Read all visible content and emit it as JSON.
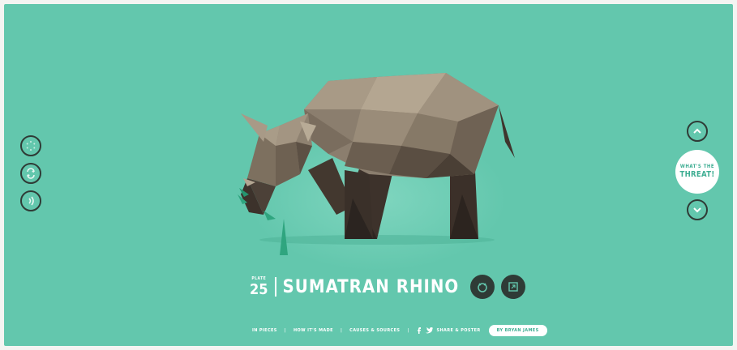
{
  "plate": {
    "label": "PLATE",
    "number": "25"
  },
  "animal_name": "SUMATRAN RHINO",
  "side_nav_left": [
    {
      "icon": "dots-ring-icon"
    },
    {
      "icon": "shuffle-icon"
    },
    {
      "icon": "sound-icon"
    }
  ],
  "side_nav_right": {
    "up_icon": "chevron-up-icon",
    "down_icon": "chevron-down-icon",
    "threat_line1": "WHAT'S THE",
    "threat_line2": "THREAT!"
  },
  "title_actions": [
    {
      "icon": "animal-face-icon"
    },
    {
      "icon": "expand-icon"
    }
  ],
  "footer": {
    "link1": "IN PIECES",
    "link2": "HOW IT'S MADE",
    "link3": "CAUSES & SOURCES",
    "share_label": "SHARE & POSTER",
    "byline": "BY BRYAN JAMES",
    "separator": "|"
  },
  "colors": {
    "background": "#63c7ad",
    "dark": "#2f3b36",
    "accent": "#3fae93",
    "rhino_light": "#ad9f8c",
    "rhino_dark": "#4b3f35",
    "grass": "#2fa57f"
  }
}
